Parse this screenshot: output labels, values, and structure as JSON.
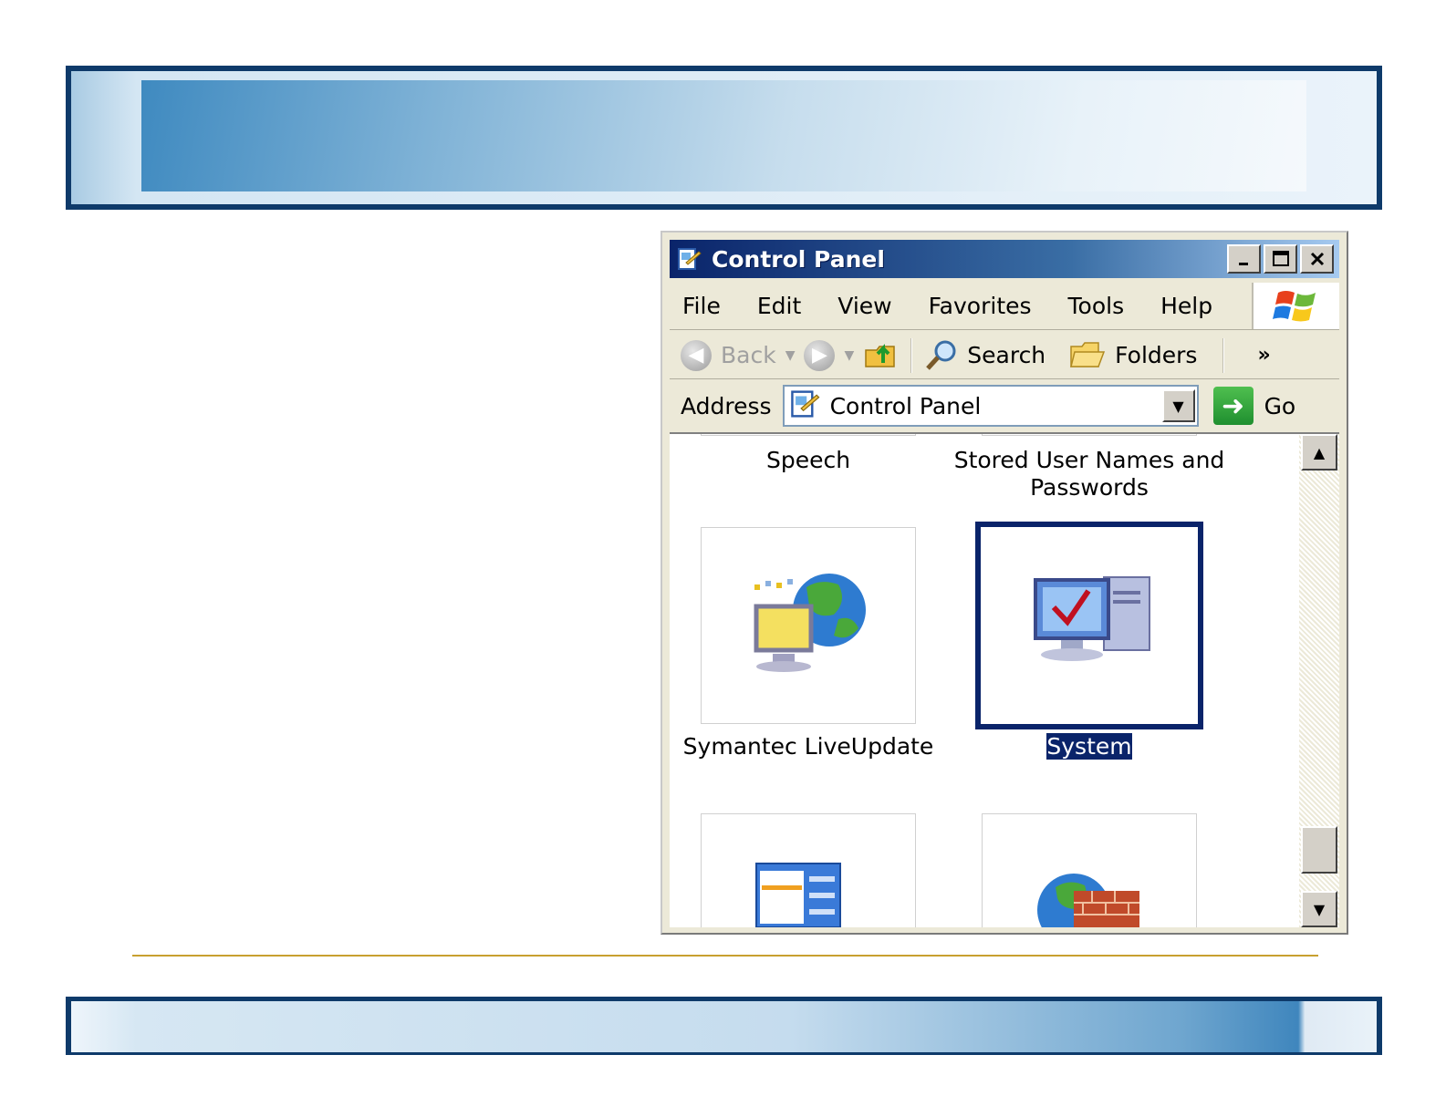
{
  "window": {
    "title": "Control Panel"
  },
  "menu": [
    "File",
    "Edit",
    "View",
    "Favorites",
    "Tools",
    "Help"
  ],
  "toolbar": {
    "back_label": "Back",
    "search_label": "Search",
    "folders_label": "Folders",
    "overflow_label": "»"
  },
  "address": {
    "label": "Address",
    "value": "Control Panel",
    "go_label": "Go"
  },
  "items": {
    "speech": "Speech",
    "stored_user_names_line1": "Stored User Names and",
    "stored_user_names_line2": "Passwords",
    "symantec": "Symantec LiveUpdate",
    "system": "System"
  },
  "colors": {
    "title_blue": "#0a246a",
    "selection": "#0a246a",
    "accent_rule": "#c8a030"
  }
}
